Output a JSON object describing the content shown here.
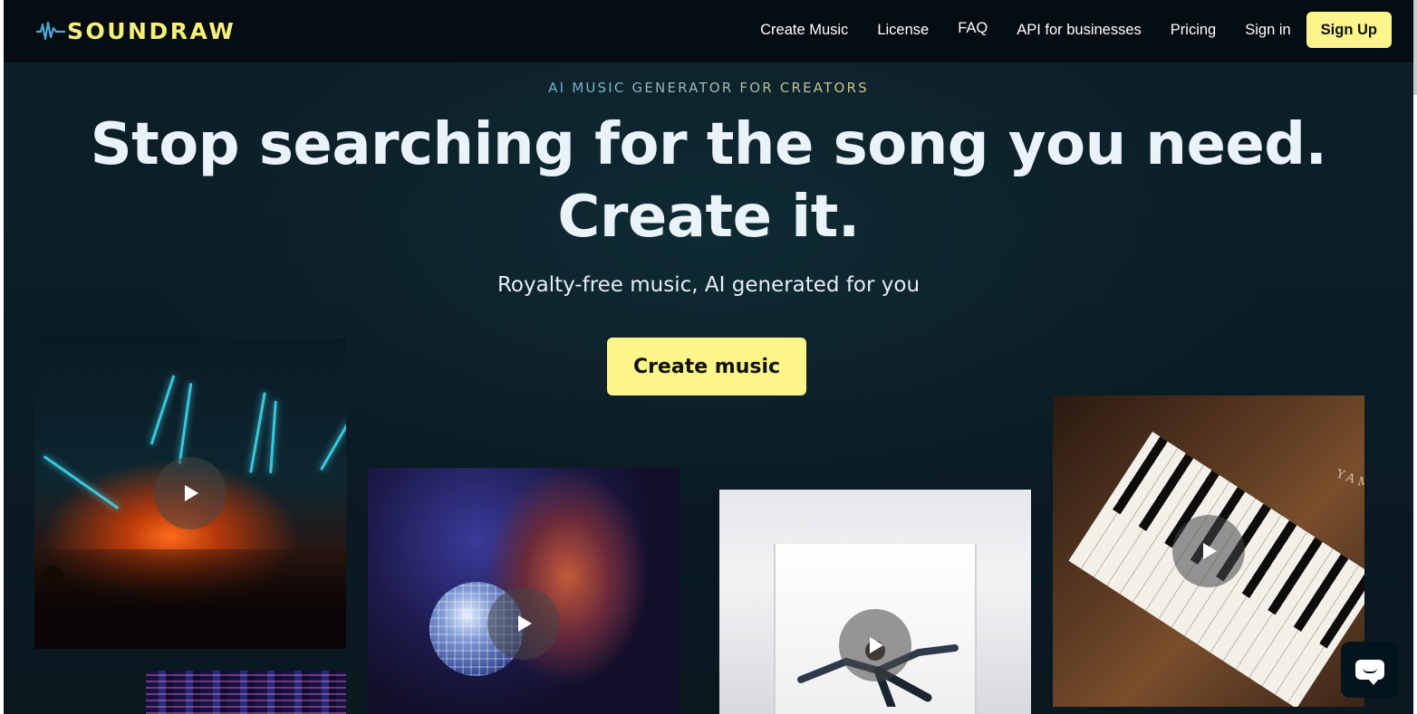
{
  "brand": {
    "name": "SOUNDRAW",
    "logo_color": "#f8f07a"
  },
  "nav": {
    "items": [
      {
        "label": "Create Music"
      },
      {
        "label": "License"
      },
      {
        "label": "FAQ"
      },
      {
        "label": "API for businesses"
      },
      {
        "label": "Pricing"
      },
      {
        "label": "Sign in"
      }
    ],
    "signup_label": "Sign Up"
  },
  "hero": {
    "eyebrow": "AI MUSIC GENERATOR FOR CREATORS",
    "headline_line1": "Stop searching for the song you need.",
    "headline_line2": "Create it.",
    "subheadline": "Royalty-free music, AI generated for you",
    "cta_label": "Create music",
    "accent_color": "#fbf58c"
  },
  "cards": [
    {
      "image": "concert-lights",
      "icon": "play-icon"
    },
    {
      "image": "woman-with-disco-ball",
      "icon": "play-icon"
    },
    {
      "image": "dancer-in-white-corridor",
      "icon": "play-icon"
    },
    {
      "image": "hands-on-piano",
      "icon": "play-icon",
      "photo_text": "YAM"
    },
    {
      "image": "neon-city-night",
      "icon": null
    }
  ],
  "chat": {
    "icon": "chat-bubble-icon"
  }
}
